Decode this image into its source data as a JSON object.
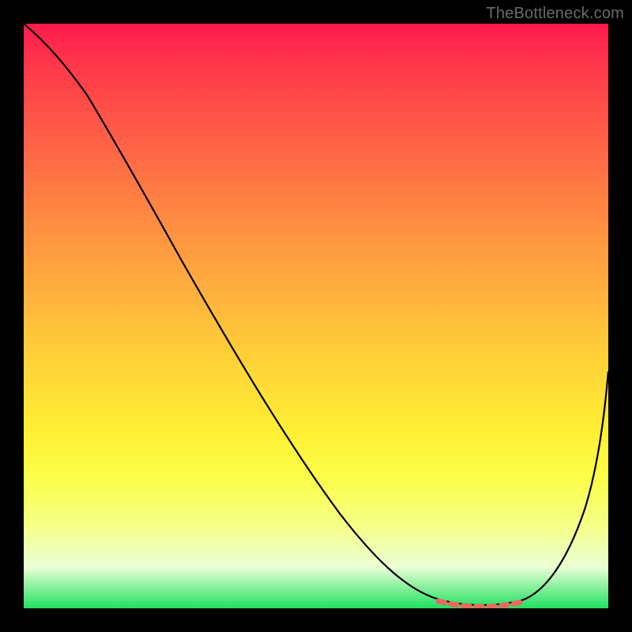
{
  "watermark": "TheBottleneck.com",
  "chart_data": {
    "type": "line",
    "title": "",
    "xlabel": "",
    "ylabel": "",
    "xlim": [
      0,
      100
    ],
    "ylim": [
      0,
      100
    ],
    "note": "Axes are unlabeled; curve descends from upper-left, bottoms out ~x 75-85, then rises to the right. Values are pixel-fraction estimates on a 0-100 scale.",
    "x": [
      0,
      5,
      10,
      15,
      20,
      25,
      30,
      35,
      40,
      45,
      50,
      55,
      60,
      65,
      70,
      73,
      76,
      80,
      84,
      87,
      90,
      93,
      96,
      100
    ],
    "y": [
      100,
      97,
      92,
      85,
      78,
      71,
      64,
      57,
      50,
      43,
      36,
      29,
      22,
      15,
      8,
      4,
      2,
      1,
      1,
      2,
      5,
      13,
      25,
      43
    ],
    "bottom_marker": {
      "note": "short coral dashed segment along the curve minimum",
      "x_range": [
        73,
        87
      ],
      "y": 1,
      "color": "#e86a5e"
    },
    "colors": {
      "curve": "#000000",
      "marker": "#e86a5e",
      "gradient_top": "#ff1a4d",
      "gradient_bottom": "#20e060",
      "frame": "#000000"
    }
  }
}
